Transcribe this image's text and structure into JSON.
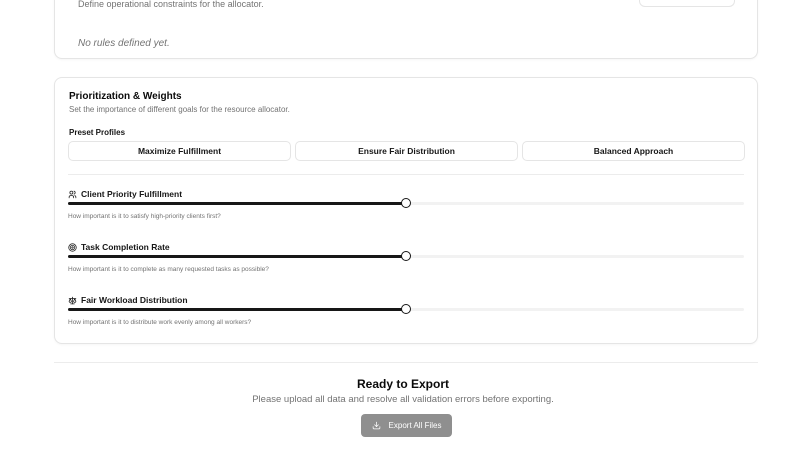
{
  "rules": {
    "description": "Define operational constraints for the allocator.",
    "empty_text": "No rules defined yet."
  },
  "weights": {
    "title": "Prioritization & Weights",
    "subtitle": "Set the importance of different goals for the resource allocator.",
    "preset_label": "Preset Profiles",
    "presets": [
      "Maximize Fulfillment",
      "Ensure Fair Distribution",
      "Balanced Approach"
    ],
    "criteria": [
      {
        "label": "Client Priority Fulfillment",
        "icon": "users-icon",
        "value": 0.5,
        "help": "How important is it to satisfy high-priority clients first?"
      },
      {
        "label": "Task Completion Rate",
        "icon": "target-icon",
        "value": 0.5,
        "help": "How important is it to complete as many requested tasks as possible?"
      },
      {
        "label": "Fair Workload Distribution",
        "icon": "scale-icon",
        "value": 0.5,
        "help": "How important is it to distribute work evenly among all workers?"
      }
    ]
  },
  "export": {
    "title": "Ready to Export",
    "description": "Please upload all data and resolve all validation errors before exporting.",
    "button_label": "Export All Files",
    "button_icon": "download-icon"
  }
}
